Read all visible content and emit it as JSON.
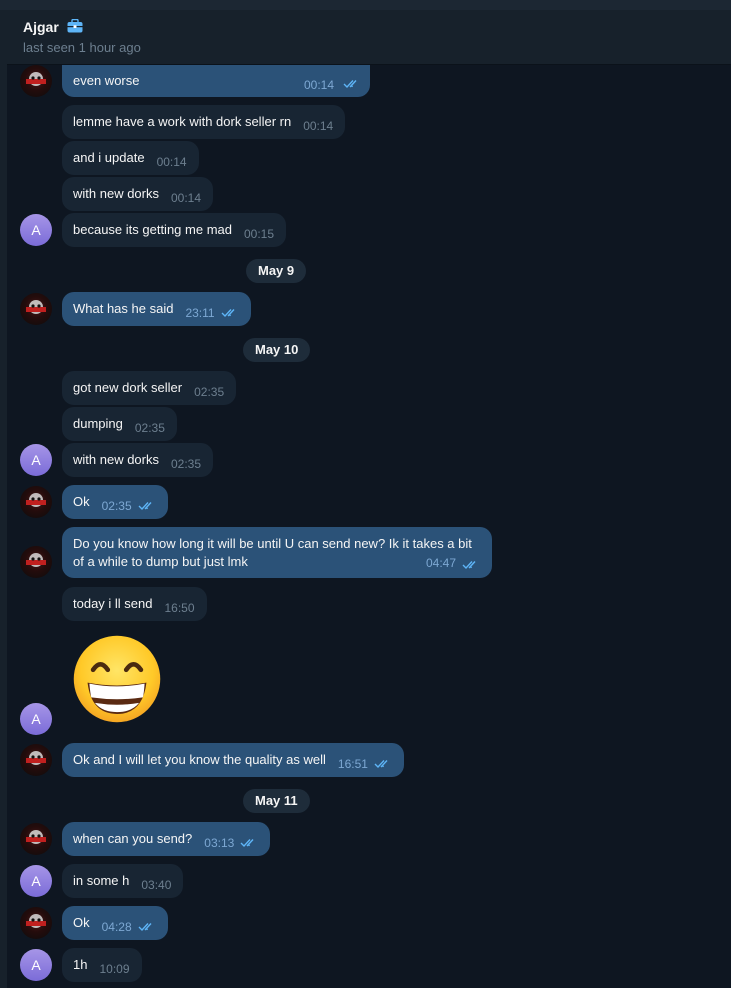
{
  "header": {
    "name": "Ajgar",
    "status": "last seen 1 hour ago"
  },
  "messages": [
    {
      "text": "even worse",
      "time": "00:14"
    },
    {
      "text": "lemme have a work with dork seller rn",
      "time": "00:14"
    },
    {
      "text": "and i update",
      "time": "00:14"
    },
    {
      "text": "with new dorks",
      "time": "00:14"
    },
    {
      "text": "because its getting me mad",
      "time": "00:15"
    },
    {
      "text": "What has he said",
      "time": "23:11"
    },
    {
      "text": "got new dork seller",
      "time": "02:35"
    },
    {
      "text": "dumping",
      "time": "02:35"
    },
    {
      "text": "with new dorks",
      "time": "02:35"
    },
    {
      "text": "Ok",
      "time": "02:35"
    },
    {
      "text": "Do you know how long it will be until U can send new? Ik it takes a bit of a while to dump but just lmk",
      "time": "04:47"
    },
    {
      "text": "today i ll send",
      "time": "16:50"
    },
    {
      "text": "Ok and I will let you know the quality as well",
      "time": "16:51"
    },
    {
      "text": "when can you send?",
      "time": "03:13"
    },
    {
      "text": "in some h",
      "time": "03:40"
    },
    {
      "text": "Ok",
      "time": "04:28"
    },
    {
      "text": "1h",
      "time": "10:09"
    }
  ],
  "dates": [
    "May 9",
    "May 10",
    "May 11"
  ],
  "avatar_letter": "A",
  "colors": {
    "background": "#0e1621",
    "header": "#17212b",
    "incoming_bubble": "#182533",
    "outgoing_bubble": "#2b5278",
    "accent": "#5eb5f7",
    "avatar": "#8e7cdf"
  },
  "icons": {
    "briefcase": "briefcase-icon",
    "read_receipt": "double-check-icon",
    "sticker": "grinning-face-emoji"
  }
}
